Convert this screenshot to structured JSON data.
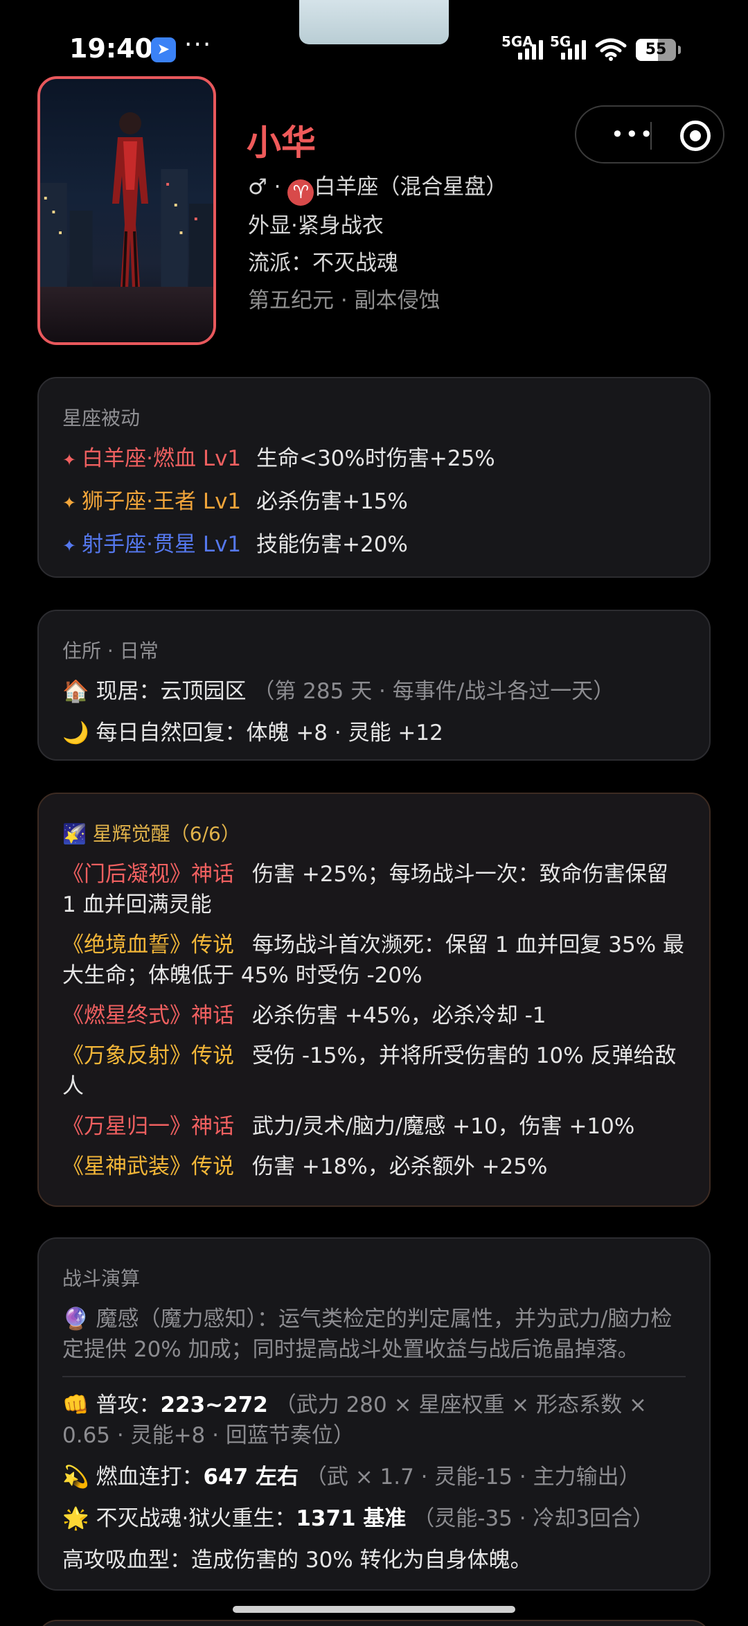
{
  "status_bar": {
    "time": "19:40",
    "more": "···",
    "net1": "5GA",
    "net2": "5G",
    "battery": "55",
    "battery_level": 0.55
  },
  "capsule": {
    "more_icon": "more-dots-icon",
    "close_icon": "target-close-icon"
  },
  "profile": {
    "name": "小华",
    "gender": "♂",
    "constellation_symbol": "♈",
    "line1_rest": "白羊座（混合星盘）",
    "line2": "外显·紧身战衣",
    "line3": "流派：不灭战魂",
    "line4": "第五纪元 · 副本侵蚀"
  },
  "passive": {
    "title": "星座被动",
    "items": [
      {
        "icon": "✦",
        "name": "白羊座·燃血 Lv1",
        "effect": "生命<30%时伤害+25%",
        "color": "#f06060"
      },
      {
        "icon": "✦",
        "name": "狮子座·王者 Lv1",
        "effect": "必杀伤害+15%",
        "color": "#f2a53a"
      },
      {
        "icon": "✦",
        "name": "射手座·贯星 Lv1",
        "effect": "技能伤害+20%",
        "color": "#5578ee"
      }
    ]
  },
  "residence": {
    "title": "住所 · 日常",
    "home_icon": "🏠",
    "home_label": "现居：云顶园区",
    "home_note": "（第 285 天 · 每事件/战斗各过一天）",
    "recover_icon": "🌙",
    "recover": "每日自然回复：体魄 +8 · 灵能 +12"
  },
  "awakening": {
    "title_icon": "🌠",
    "title": "星辉觉醒（6/6）",
    "items": [
      {
        "name": "《门后凝视》神话",
        "tier_color": "#f06060",
        "effect": "伤害 +25%；每场战斗一次：致命伤害保留 1 血并回满灵能"
      },
      {
        "name": "《绝境血誓》传说",
        "tier_color": "#f2b638",
        "effect": "每场战斗首次濒死：保留 1 血并回复 35% 最大生命；体魄低于 45% 时受伤 -20%"
      },
      {
        "name": "《燃星终式》神话",
        "tier_color": "#f06060",
        "effect": "必杀伤害 +45%，必杀冷却 -1"
      },
      {
        "name": "《万象反射》传说",
        "tier_color": "#f2b638",
        "effect": "受伤 -15%，并将所受伤害的 10% 反弹给敌人"
      },
      {
        "name": "《万星归一》神话",
        "tier_color": "#f06060",
        "effect": "武力/灵术/脑力/魔感 +10，伤害 +10%"
      },
      {
        "name": "《星神武装》传说",
        "tier_color": "#f2b638",
        "effect": "伤害 +18%，必杀额外 +25%"
      }
    ]
  },
  "combat": {
    "title": "战斗演算",
    "note_icon": "🔮",
    "note": "魔感（魔力感知）：运气类检定的判定属性，并为武力/脑力检定提供 20% 加成；同时提高战斗处置收益与战后诡晶掉落。",
    "attack_icon": "👊",
    "attack_label": "普攻：",
    "attack_value": "223~272",
    "attack_note": "（武力 280 × 星座权重 × 形态系数 × 0.65 · 灵能+8 · 回蓝节奏位）",
    "combo_icon": "💫",
    "combo_label": "燃血连打：",
    "combo_value": "647 左右",
    "combo_note": "（武 × 1.7 · 灵能-15 · 主力输出）",
    "ult_icon": "🌟",
    "ult_label": "不灭战魂·狱火重生：",
    "ult_value": "1371 基准",
    "ult_note": "（灵能-35 · 冷却3回合）",
    "lifesteal": "高攻吸血型：造成伤害的 30% 转化为自身体魄。"
  }
}
